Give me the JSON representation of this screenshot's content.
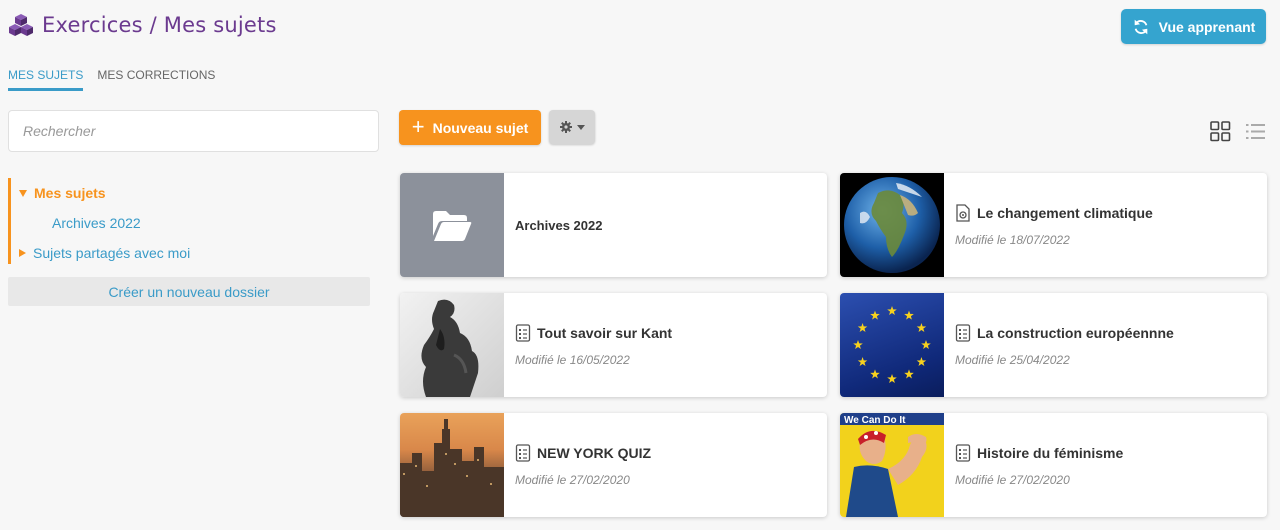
{
  "header": {
    "title": "Exercices / Mes sujets",
    "vue_button": "Vue apprenant"
  },
  "tabs": [
    {
      "label": "MES SUJETS"
    },
    {
      "label": "MES CORRECTIONS"
    }
  ],
  "search": {
    "placeholder": "Rechercher"
  },
  "tree": {
    "root": "Mes sujets",
    "child": "Archives 2022",
    "shared": "Sujets partagés avec moi",
    "new_folder": "Créer un nouveau dossier"
  },
  "toolbar": {
    "new_label": "Nouveau sujet"
  },
  "cards": [
    {
      "title": "Archives 2022",
      "date": ""
    },
    {
      "title": "Le changement climatique",
      "date": "Modifié le 18/07/2022"
    },
    {
      "title": "Tout savoir sur Kant",
      "date": "Modifié le 16/05/2022"
    },
    {
      "title": "La construction européennne",
      "date": "Modifié le 25/04/2022"
    },
    {
      "title": "NEW YORK QUIZ",
      "date": "Modifié le 27/02/2020"
    },
    {
      "title": "Histoire du féminisme",
      "date": "Modifié le 27/02/2020"
    }
  ],
  "thumb_text": {
    "poster": "We Can Do It"
  },
  "colors": {
    "brand_purple": "#6b3a8f",
    "accent_blue": "#35a4cf",
    "accent_orange": "#f7931e"
  }
}
